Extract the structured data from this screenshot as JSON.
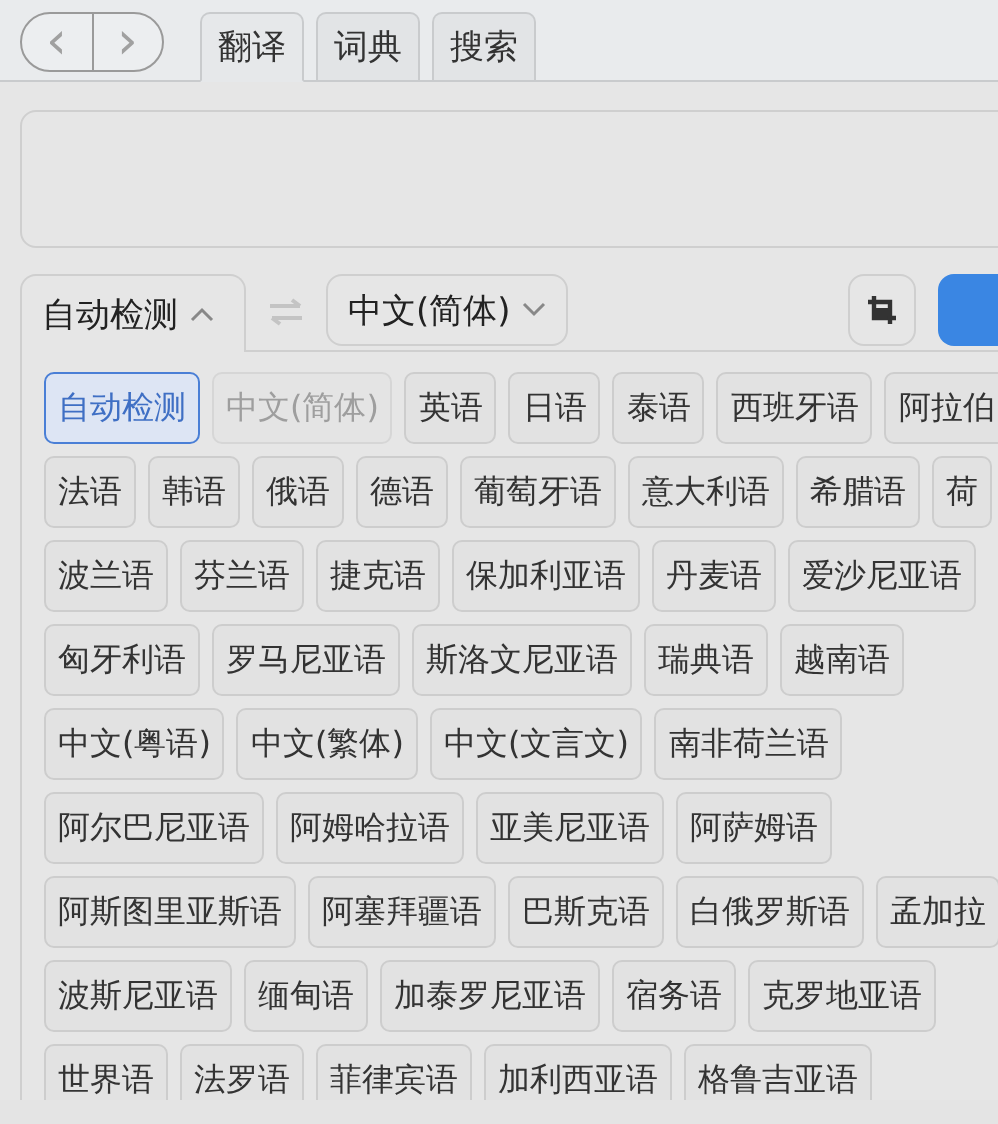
{
  "nav": {
    "back": "‹",
    "forward": "›"
  },
  "tabs": [
    {
      "label": "翻译",
      "selected": true
    },
    {
      "label": "词典",
      "selected": false
    },
    {
      "label": "搜索",
      "selected": false
    }
  ],
  "source_language": {
    "label": "自动检测",
    "expanded": true
  },
  "target_language": {
    "label": "中文(简体)",
    "expanded": false
  },
  "language_rows": [
    [
      {
        "label": "自动检测",
        "selected": true,
        "disabled": false
      },
      {
        "label": "中文(简体)",
        "selected": false,
        "disabled": true
      },
      {
        "label": "英语",
        "selected": false,
        "disabled": false
      },
      {
        "label": "日语",
        "selected": false,
        "disabled": false
      },
      {
        "label": "泰语",
        "selected": false,
        "disabled": false
      },
      {
        "label": "西班牙语",
        "selected": false,
        "disabled": false
      },
      {
        "label": "阿拉伯",
        "selected": false,
        "disabled": false
      }
    ],
    [
      {
        "label": "法语",
        "selected": false,
        "disabled": false
      },
      {
        "label": "韩语",
        "selected": false,
        "disabled": false
      },
      {
        "label": "俄语",
        "selected": false,
        "disabled": false
      },
      {
        "label": "德语",
        "selected": false,
        "disabled": false
      },
      {
        "label": "葡萄牙语",
        "selected": false,
        "disabled": false
      },
      {
        "label": "意大利语",
        "selected": false,
        "disabled": false
      },
      {
        "label": "希腊语",
        "selected": false,
        "disabled": false
      },
      {
        "label": "荷",
        "selected": false,
        "disabled": false
      }
    ],
    [
      {
        "label": "波兰语",
        "selected": false,
        "disabled": false
      },
      {
        "label": "芬兰语",
        "selected": false,
        "disabled": false
      },
      {
        "label": "捷克语",
        "selected": false,
        "disabled": false
      },
      {
        "label": "保加利亚语",
        "selected": false,
        "disabled": false
      },
      {
        "label": "丹麦语",
        "selected": false,
        "disabled": false
      },
      {
        "label": "爱沙尼亚语",
        "selected": false,
        "disabled": false
      }
    ],
    [
      {
        "label": "匈牙利语",
        "selected": false,
        "disabled": false
      },
      {
        "label": "罗马尼亚语",
        "selected": false,
        "disabled": false
      },
      {
        "label": "斯洛文尼亚语",
        "selected": false,
        "disabled": false
      },
      {
        "label": "瑞典语",
        "selected": false,
        "disabled": false
      },
      {
        "label": "越南语",
        "selected": false,
        "disabled": false
      }
    ],
    [
      {
        "label": "中文(粤语)",
        "selected": false,
        "disabled": false
      },
      {
        "label": "中文(繁体)",
        "selected": false,
        "disabled": false
      },
      {
        "label": "中文(文言文)",
        "selected": false,
        "disabled": false
      },
      {
        "label": "南非荷兰语",
        "selected": false,
        "disabled": false
      }
    ],
    [
      {
        "label": "阿尔巴尼亚语",
        "selected": false,
        "disabled": false
      },
      {
        "label": "阿姆哈拉语",
        "selected": false,
        "disabled": false
      },
      {
        "label": "亚美尼亚语",
        "selected": false,
        "disabled": false
      },
      {
        "label": "阿萨姆语",
        "selected": false,
        "disabled": false
      }
    ],
    [
      {
        "label": "阿斯图里亚斯语",
        "selected": false,
        "disabled": false
      },
      {
        "label": "阿塞拜疆语",
        "selected": false,
        "disabled": false
      },
      {
        "label": "巴斯克语",
        "selected": false,
        "disabled": false
      },
      {
        "label": "白俄罗斯语",
        "selected": false,
        "disabled": false
      },
      {
        "label": "孟加拉",
        "selected": false,
        "disabled": false
      }
    ],
    [
      {
        "label": "波斯尼亚语",
        "selected": false,
        "disabled": false
      },
      {
        "label": "缅甸语",
        "selected": false,
        "disabled": false
      },
      {
        "label": "加泰罗尼亚语",
        "selected": false,
        "disabled": false
      },
      {
        "label": "宿务语",
        "selected": false,
        "disabled": false
      },
      {
        "label": "克罗地亚语",
        "selected": false,
        "disabled": false
      }
    ],
    [
      {
        "label": "世界语",
        "selected": false,
        "disabled": false
      },
      {
        "label": "法罗语",
        "selected": false,
        "disabled": false
      },
      {
        "label": "菲律宾语",
        "selected": false,
        "disabled": false
      },
      {
        "label": "加利西亚语",
        "selected": false,
        "disabled": false
      },
      {
        "label": "格鲁吉亚语",
        "selected": false,
        "disabled": false
      }
    ]
  ]
}
